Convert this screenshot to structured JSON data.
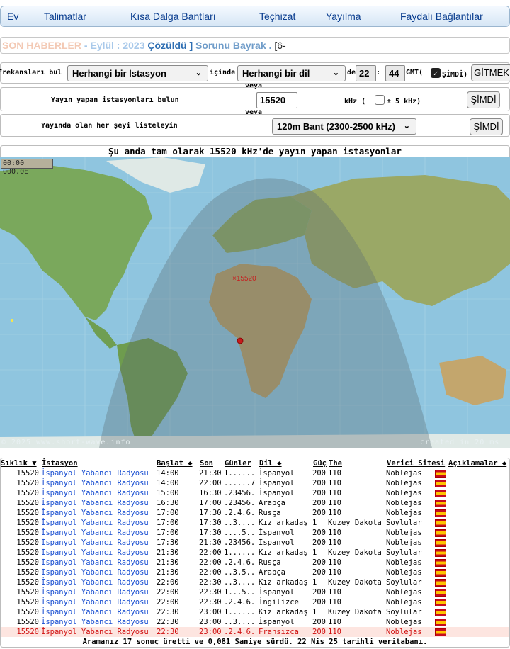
{
  "nav": [
    "Ev",
    "Talimatlar",
    "Kısa Dalga Bantları",
    "Teçhizat",
    "Yayılma",
    "Faydalı Bağlantılar"
  ],
  "news": {
    "part1": "SON HABERLER",
    "part2": " - Eylül : 2023 ",
    "part3": "Çözüldü ] ",
    "part4": "Sorunu Bayrak . ",
    "part5": "[6-"
  },
  "form": {
    "row1_label": "Frekansları bul",
    "station_select": "Herhangi bir İstasyon",
    "within_label": "içinde",
    "language_select": "Herhangi bir dil",
    "at_label": "de",
    "hour": "22",
    "colon": ":",
    "minute": "44",
    "gmt_label": "GMT(",
    "now_check_label": "ŞİMDİ)",
    "go_button": "GİTMEK",
    "or1": "veya",
    "row2_label": "Yayın yapan istasyonları bulun",
    "freq_value": "15520",
    "khz_label": "kHz (",
    "pm5_label": "± 5 kHz)",
    "now_button_2": "ŞİMDİ",
    "or2": "veya",
    "row3_label": "Yayında olan her şeyi listeleyin",
    "band_select": "120m Bant (2300-2500 kHz)",
    "now_button_3": "ŞİMDİ"
  },
  "map": {
    "title": "Şu anda tam olarak 15520 kHz'de yayın yapan istasyonlar",
    "clock": "00:00 000.0E",
    "marker_label": "×15520",
    "copyright": "© 2025 www.short-wave.info",
    "created": "created in 20 ms"
  },
  "table": {
    "headers": {
      "freq": "Sıklık ▼",
      "station": "İstasyon",
      "start": "Başlat ◆",
      "end": "Son",
      "days": "Günler",
      "lang": "Dil ◆",
      "power": "Güç",
      "the": "The",
      "site": "Verici Sitesi",
      "notes": "Açıklamalar ◆"
    },
    "rows": [
      {
        "freq": "15520",
        "station": "İspanyol Yabancı Radyosu",
        "start": "14:00",
        "end": "21:30",
        "days": "1......",
        "lang": "İspanyol",
        "power": "200",
        "azi": "110",
        "site": "Noblejas"
      },
      {
        "freq": "15520",
        "station": "İspanyol Yabancı Radyosu",
        "start": "14:00",
        "end": "22:00",
        "days": "......7",
        "lang": "İspanyol",
        "power": "200",
        "azi": "110",
        "site": "Noblejas"
      },
      {
        "freq": "15520",
        "station": "İspanyol Yabancı Radyosu",
        "start": "15:00",
        "end": "16:30",
        "days": ".23456.",
        "lang": "İspanyol",
        "power": "200",
        "azi": "110",
        "site": "Noblejas"
      },
      {
        "freq": "15520",
        "station": "İspanyol Yabancı Radyosu",
        "start": "16:30",
        "end": "17:00",
        "days": ".23456.",
        "lang": "Arapça",
        "power": "200",
        "azi": "110",
        "site": "Noblejas"
      },
      {
        "freq": "15520",
        "station": "İspanyol Yabancı Radyosu",
        "start": "17:00",
        "end": "17:30",
        "days": ".2.4.6.",
        "lang": "Rusça",
        "power": "200",
        "azi": "110",
        "site": "Noblejas"
      },
      {
        "freq": "15520",
        "station": "İspanyol Yabancı Radyosu",
        "start": "17:00",
        "end": "17:30",
        "days": "..3....",
        "lang": "Kız arkadaş",
        "power": "1",
        "azi": "Kuzey Dakota",
        "site": "Soylular"
      },
      {
        "freq": "15520",
        "station": "İspanyol Yabancı Radyosu",
        "start": "17:00",
        "end": "17:30",
        "days": "....5..",
        "lang": "İspanyol",
        "power": "200",
        "azi": "110",
        "site": "Noblejas"
      },
      {
        "freq": "15520",
        "station": "İspanyol Yabancı Radyosu",
        "start": "17:30",
        "end": "21:30",
        "days": ".23456.",
        "lang": "İspanyol",
        "power": "200",
        "azi": "110",
        "site": "Noblejas"
      },
      {
        "freq": "15520",
        "station": "İspanyol Yabancı Radyosu",
        "start": "21:30",
        "end": "22:00",
        "days": "1......",
        "lang": "Kız arkadaş",
        "power": "1",
        "azi": "Kuzey Dakota",
        "site": "Soylular"
      },
      {
        "freq": "15520",
        "station": "İspanyol Yabancı Radyosu",
        "start": "21:30",
        "end": "22:00",
        "days": ".2.4.6.",
        "lang": "Rusça",
        "power": "200",
        "azi": "110",
        "site": "Noblejas"
      },
      {
        "freq": "15520",
        "station": "İspanyol Yabancı Radyosu",
        "start": "21:30",
        "end": "22:00",
        "days": "..3.5..",
        "lang": "Arapça",
        "power": "200",
        "azi": "110",
        "site": "Noblejas"
      },
      {
        "freq": "15520",
        "station": "İspanyol Yabancı Radyosu",
        "start": "22:00",
        "end": "22:30",
        "days": "..3....",
        "lang": "Kız arkadaş",
        "power": "1",
        "azi": "Kuzey Dakota",
        "site": "Soylular"
      },
      {
        "freq": "15520",
        "station": "İspanyol Yabancı Radyosu",
        "start": "22:00",
        "end": "22:30",
        "days": "1...5..",
        "lang": "İspanyol",
        "power": "200",
        "azi": "110",
        "site": "Noblejas"
      },
      {
        "freq": "15520",
        "station": "İspanyol Yabancı Radyosu",
        "start": "22:00",
        "end": "22:30",
        "days": ".2.4.6.",
        "lang": "İngilizce",
        "power": "200",
        "azi": "110",
        "site": "Noblejas"
      },
      {
        "freq": "15520",
        "station": "İspanyol Yabancı Radyosu",
        "start": "22:30",
        "end": "23:00",
        "days": "1......",
        "lang": "Kız arkadaş",
        "power": "1",
        "azi": "Kuzey Dakota",
        "site": "Soylular"
      },
      {
        "freq": "15520",
        "station": "İspanyol Yabancı Radyosu",
        "start": "22:30",
        "end": "23:00",
        "days": "..3....",
        "lang": "İspanyol",
        "power": "200",
        "azi": "110",
        "site": "Noblejas"
      },
      {
        "freq": "15520",
        "station": "İspanyol Yabancı Radyosu",
        "start": "22:30",
        "end": "23:00",
        "days": ".2.4.6.",
        "lang": "Fransızca",
        "power": "200",
        "azi": "110",
        "site": "Noblejas"
      }
    ],
    "footer": "Aramanız 17 sonuç üretti ve 0,081 Saniye sürdü. 22 Nis 25 tarihli veritabanı."
  }
}
